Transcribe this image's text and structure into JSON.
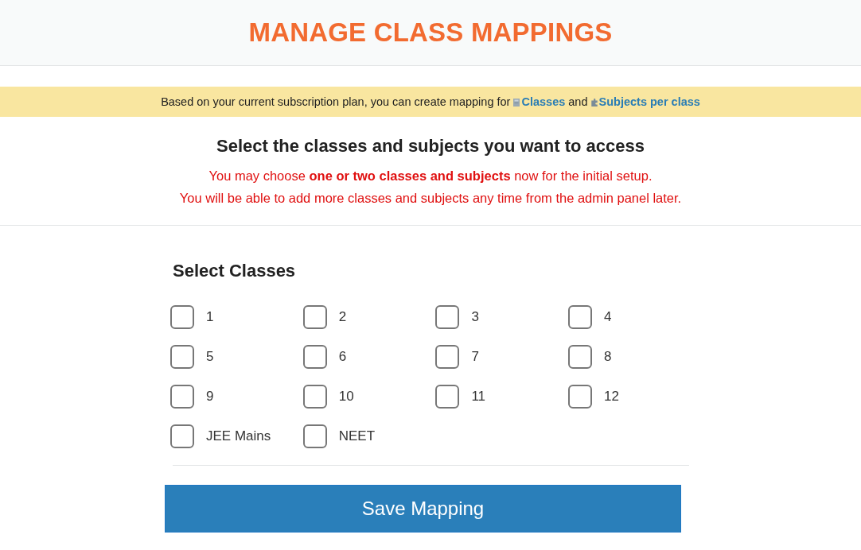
{
  "header": {
    "title": "MANAGE CLASS MAPPINGS"
  },
  "plan_banner": {
    "text": "Based on your current subscription plan, you can create mapping for",
    "joiner": "and",
    "links": [
      {
        "label": "Classes"
      },
      {
        "label": "Subjects per class"
      }
    ]
  },
  "intro": {
    "heading": "Select the classes and subjects you want to access",
    "notes": [
      "You may choose **one or two classes and subjects** now for the initial setup.",
      "You will be able to add more classes and subjects any time from the admin panel later."
    ]
  },
  "classes": {
    "heading": "Select Classes",
    "items": [
      {
        "label": "1",
        "checked": false
      },
      {
        "label": "2",
        "checked": false
      },
      {
        "label": "3",
        "checked": false
      },
      {
        "label": "4",
        "checked": false
      },
      {
        "label": "5",
        "checked": false
      },
      {
        "label": "6",
        "checked": false
      },
      {
        "label": "7",
        "checked": false
      },
      {
        "label": "8",
        "checked": false
      },
      {
        "label": "9",
        "checked": false
      },
      {
        "label": "10",
        "checked": false
      },
      {
        "label": "11",
        "checked": false
      },
      {
        "label": "12",
        "checked": false
      },
      {
        "label": "JEE Mains",
        "checked": false
      },
      {
        "label": "NEET",
        "checked": false
      }
    ]
  },
  "save_button": {
    "label": "Save Mapping"
  }
}
